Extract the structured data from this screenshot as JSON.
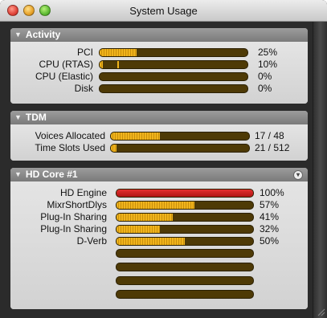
{
  "window": {
    "title": "System Usage"
  },
  "sections": {
    "activity": {
      "title": "Activity",
      "rows": [
        {
          "label": "PCI",
          "value": "25%",
          "fill": 0.25
        },
        {
          "label": "CPU (RTAS)",
          "value": "10%",
          "fill": 0.02,
          "peak": 0.12
        },
        {
          "label": "CPU (Elastic)",
          "value": "0%",
          "fill": 0
        },
        {
          "label": "Disk",
          "value": "0%",
          "fill": 0
        }
      ]
    },
    "tdm": {
      "title": "TDM",
      "rows": [
        {
          "label": "Voices Allocated",
          "value": "17 / 48",
          "fill": 0.354
        },
        {
          "label": "Time Slots Used",
          "value": "21 / 512",
          "fill": 0.041
        }
      ]
    },
    "hdcore": {
      "title": "HD Core #1",
      "rows": [
        {
          "label": "HD Engine",
          "value": "100%",
          "fill": 1.0,
          "color": "#c41a1a"
        },
        {
          "label": "MixrShortDlys",
          "value": "57%",
          "fill": 0.57
        },
        {
          "label": "Plug-In Sharing",
          "value": "41%",
          "fill": 0.41
        },
        {
          "label": "Plug-In Sharing",
          "value": "32%",
          "fill": 0.32
        },
        {
          "label": "D-Verb",
          "value": "50%",
          "fill": 0.5
        },
        {
          "label": "",
          "value": "",
          "fill": 0
        },
        {
          "label": "",
          "value": "",
          "fill": 0
        },
        {
          "label": "",
          "value": "",
          "fill": 0
        },
        {
          "label": "",
          "value": "",
          "fill": 0
        }
      ]
    }
  },
  "colors": {
    "meter_fill": "#f0b41c",
    "meter_track": "#4e3a06",
    "meter_full": "#c41a1a"
  }
}
